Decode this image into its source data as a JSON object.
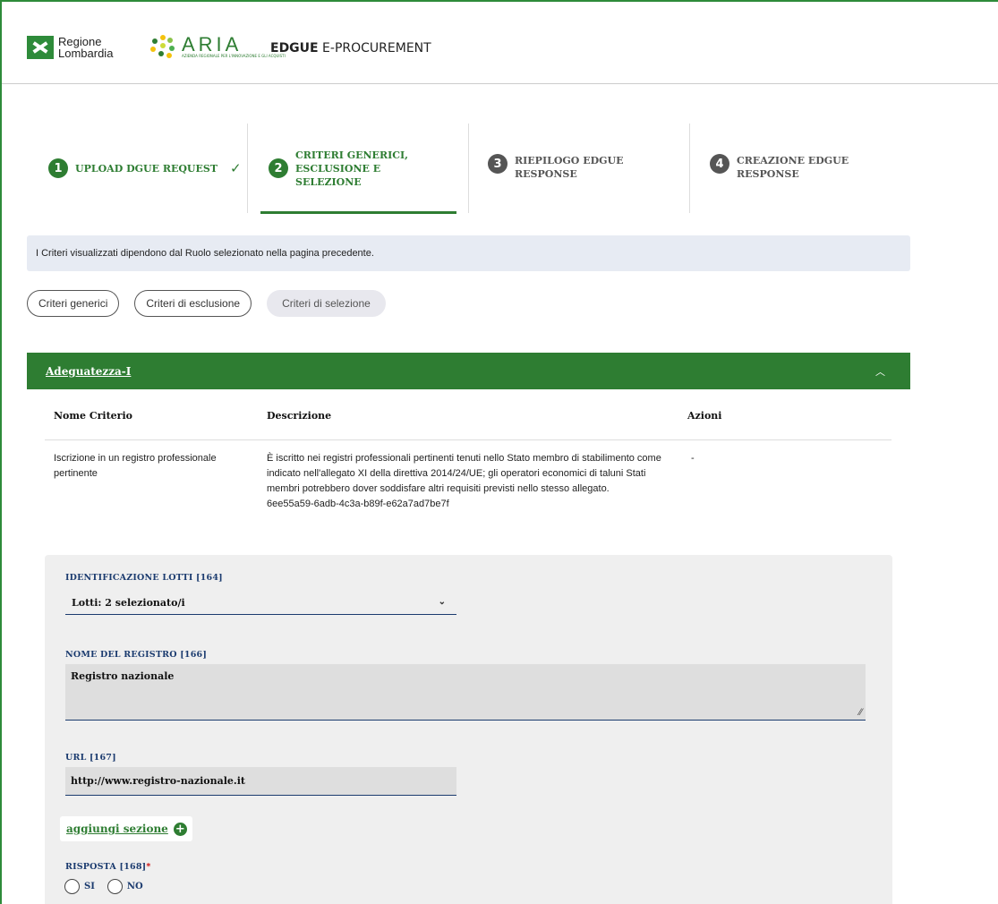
{
  "header": {
    "brand1_line1": "Regione",
    "brand1_line2": "Lombardia",
    "brand2": "ARIA",
    "brand2_sub": "AZIENDA REGIONALE PER L'INNOVAZIONE E GLI ACQUISTI",
    "title_bold": "EDGUE",
    "title_rest": " E-PROCUREMENT"
  },
  "steps": [
    {
      "num": "1",
      "label": "UPLOAD DGUE REQUEST",
      "state": "done"
    },
    {
      "num": "2",
      "label": "CRITERI GENERICI, ESCLUSIONE E SELEZIONE",
      "state": "active"
    },
    {
      "num": "3",
      "label": "RIEPILOGO EDGUE RESPONSE",
      "state": "todo"
    },
    {
      "num": "4",
      "label": "CREAZIONE EDGUE RESPONSE",
      "state": "todo"
    }
  ],
  "info": "I Criteri visualizzati dipendono dal Ruolo selezionato nella pagina precedente.",
  "filters": [
    "Criteri generici",
    "Criteri di esclusione",
    "Criteri di selezione"
  ],
  "section": {
    "title": "Adeguatezza-I"
  },
  "table": {
    "headers": [
      "Nome Criterio",
      "Descrizione",
      "Azioni"
    ],
    "row": {
      "name": "Iscrizione in un registro professionale pertinente",
      "description": "È iscritto nei registri professionali pertinenti tenuti nello Stato membro di stabilimento come indicato nell'allegato XI della direttiva 2014/24/UE; gli operatori economici di taluni Stati membri potrebbero dover soddisfare altri requisiti previsti nello stesso allegato.",
      "uuid": "6ee55a59-6adb-4c3a-b89f-e62a7ad7be7f",
      "actions": "-"
    }
  },
  "form": {
    "lots_label": "IDENTIFICAZIONE LOTTI [164]",
    "lots_value": "Lotti: 2 selezionato/i",
    "registry_label": "NOME DEL REGISTRO [166]",
    "registry_value": "Registro nazionale",
    "url_label": "URL [167]",
    "url_value": "http://www.registro-nazionale.it",
    "add_section": "aggiungi sezione",
    "answer_label": "RISPOSTA [168]",
    "answer_required": "*",
    "options": [
      "SI",
      "NO"
    ]
  },
  "colors": {
    "primary": "#2e7d32",
    "info_bg": "#e7ebf3",
    "label": "#1b3b6f"
  }
}
